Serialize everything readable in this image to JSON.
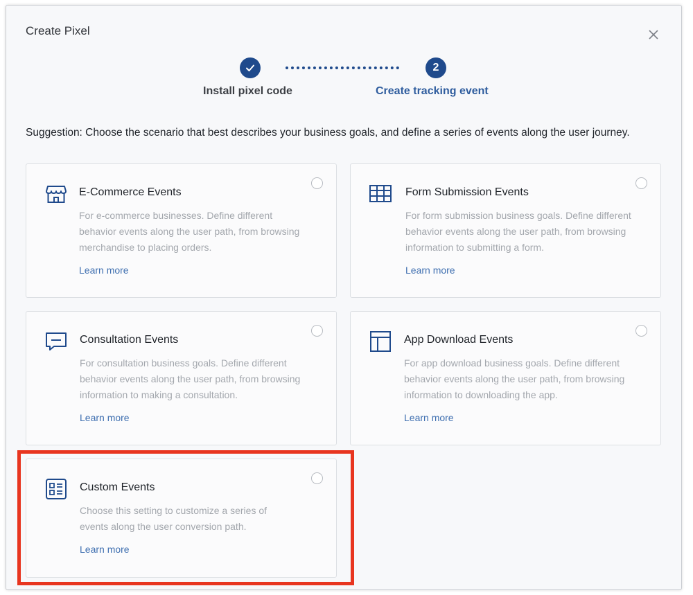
{
  "modal": {
    "title": "Create Pixel",
    "close_icon": "close-icon"
  },
  "stepper": {
    "steps": [
      {
        "label": "Install pixel code",
        "marker": "✓",
        "state": "completed"
      },
      {
        "label": "Create tracking event",
        "marker": "2",
        "state": "active"
      }
    ]
  },
  "suggestion": "Suggestion: Choose the scenario that best describes your business goals, and define a series of events along the user journey.",
  "cards": [
    {
      "title": "E-Commerce Events",
      "icon": "storefront-icon",
      "description": "For e-commerce businesses. Define different behavior events along the user path, from browsing merchandise to placing orders.",
      "link": "Learn more",
      "selected": false
    },
    {
      "title": "Form Submission Events",
      "icon": "table-icon",
      "description": "For form submission business goals. Define different behavior events along the user path, from browsing information to submitting a form.",
      "link": "Learn more",
      "selected": false
    },
    {
      "title": "Consultation Events",
      "icon": "chat-icon",
      "description": "For consultation business goals. Define different behavior events along the user path, from browsing information to making a consultation.",
      "link": "Learn more",
      "selected": false
    },
    {
      "title": "App Download Events",
      "icon": "layout-icon",
      "description": "For app download business goals. Define different behavior events along the user path, from browsing information to downloading the app.",
      "link": "Learn more",
      "selected": false
    },
    {
      "title": "Custom Events",
      "icon": "custom-list-icon",
      "description": "Choose this setting to customize a series of events along the user conversion path.",
      "link": "Learn more",
      "selected": false,
      "highlighted": true
    }
  ],
  "colors": {
    "primary": "#1f4a8c",
    "link": "#3f6fb0",
    "highlight": "#e8351f"
  }
}
